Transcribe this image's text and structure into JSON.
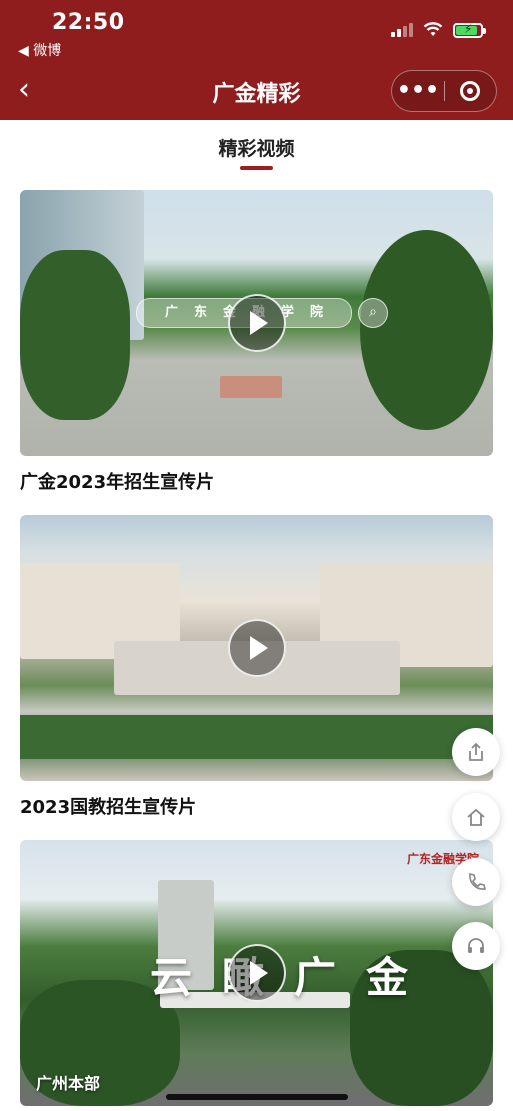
{
  "status_bar": {
    "time": "22:50",
    "back_app": "◀ 微博"
  },
  "nav": {
    "title": "广金精彩",
    "back_icon": "‹",
    "more_icon": "•••"
  },
  "tab": {
    "label": "精彩视频"
  },
  "videos": [
    {
      "caption": "广金2023年招生宣传片",
      "overlay_text": "广东金融学院"
    },
    {
      "caption": "2023国教招生宣传片"
    },
    {
      "caption": "",
      "overlay_text": "云瞰广金",
      "corner_text": "广州本部",
      "logo_text": "广东金融学院"
    }
  ],
  "floating_actions": [
    "share-icon",
    "home-icon",
    "phone-icon",
    "headset-icon"
  ],
  "colors": {
    "header": "#8f1d1d",
    "accent": "#9b1f1f"
  }
}
